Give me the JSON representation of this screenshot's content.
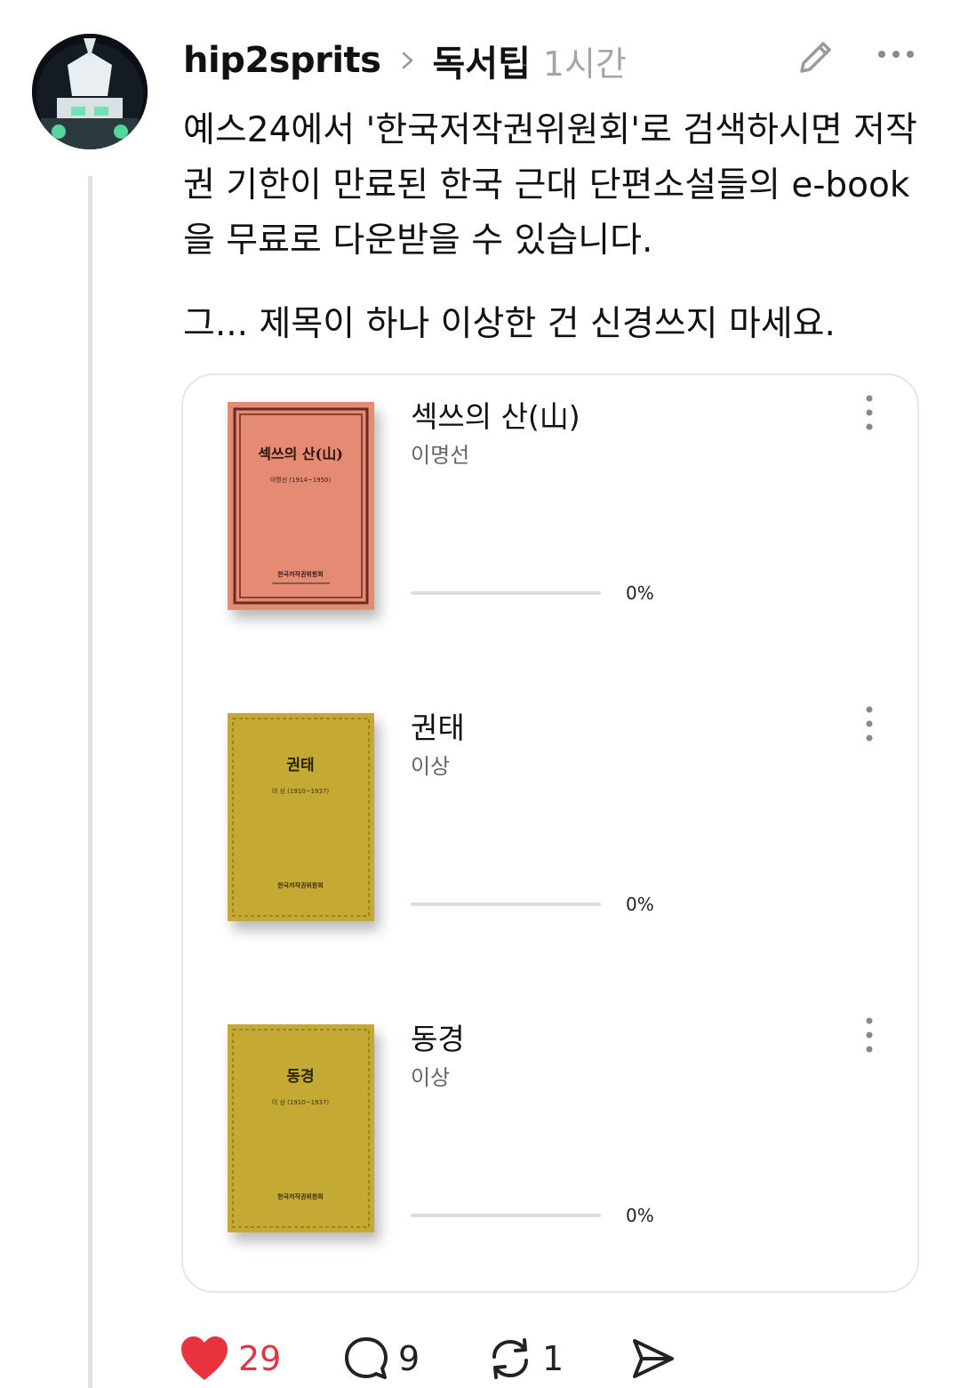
{
  "post": {
    "username": "hip2sprits",
    "topic": "독서팁",
    "time": "1시간",
    "paragraphs": [
      "예스24에서 '한국저작권위원회'로 검색하시면 저작권 기한이 만료된 한국 근대 단편소설들의 e-book을 무료로 다운받을 수 있습니다.",
      "그... 제목이 하나 이상한 건 신경쓰지 마세요."
    ],
    "icons": {
      "avatar": "robot-avatar",
      "edit": "pencil-icon",
      "more": "more-dots-icon"
    }
  },
  "books": [
    {
      "title": "섹쓰의 산(山)",
      "author": "이명선",
      "progress": 0,
      "progress_text": "0%",
      "cover_title": "섹쓰의 산(山)",
      "cover_subtitle": "이명선 (1914~1950)",
      "cover_publisher": "한국저작권위원회",
      "cover_color": "#e58a73"
    },
    {
      "title": "권태",
      "author": "이상",
      "progress": 0,
      "progress_text": "0%",
      "cover_title": "권태",
      "cover_subtitle": "이 상 (1910~1937)",
      "cover_publisher": "한국저작권위원회",
      "cover_color": "#c4aa34"
    },
    {
      "title": "동경",
      "author": "이상",
      "progress": 0,
      "progress_text": "0%",
      "cover_title": "동경",
      "cover_subtitle": "이 상 (1910~1937)",
      "cover_publisher": "한국저작권위원회",
      "cover_color": "#c4aa34"
    }
  ],
  "actions": {
    "likes": "29",
    "comments": "9",
    "reposts": "1",
    "like_color": "#e8333f"
  }
}
